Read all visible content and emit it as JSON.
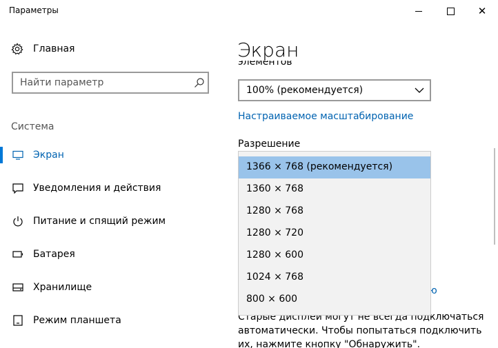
{
  "window": {
    "title": "Параметры",
    "close_glyph": "✕"
  },
  "sidebar": {
    "home_label": "Главная",
    "search_placeholder": "Найти параметр",
    "section_label": "Система",
    "items": [
      {
        "label": "Экран",
        "icon": "monitor-icon",
        "active": true
      },
      {
        "label": "Уведомления и действия",
        "icon": "notification-icon",
        "active": false
      },
      {
        "label": "Питание и спящий режим",
        "icon": "power-icon",
        "active": false
      },
      {
        "label": "Батарея",
        "icon": "battery-icon",
        "active": false
      },
      {
        "label": "Хранилище",
        "icon": "storage-icon",
        "active": false
      },
      {
        "label": "Режим планшета",
        "icon": "tablet-icon",
        "active": false
      }
    ]
  },
  "main": {
    "title": "Экран",
    "scrolled_text": "элементов",
    "scale_value": "100% (рекомендуется)",
    "custom_scaling_link": "Настраиваемое масштабирование",
    "resolution_label": "Разрешение",
    "resolution_options": [
      "1366 × 768 (рекомендуется)",
      "1360 × 768",
      "1280 × 768",
      "1280 × 720",
      "1280 × 600",
      "1024 × 768",
      "800 × 600"
    ],
    "selected_resolution_index": 0,
    "partial_link_text": "ю",
    "bottom_text": "Старые дисплеи могут не всегда подключаться автоматически. Чтобы попытаться подключить их, нажмите кнопку \"Обнаружить\"."
  },
  "colors": {
    "accent": "#0078d7",
    "link": "#0063b1",
    "selected_option": "#99c3ea"
  }
}
